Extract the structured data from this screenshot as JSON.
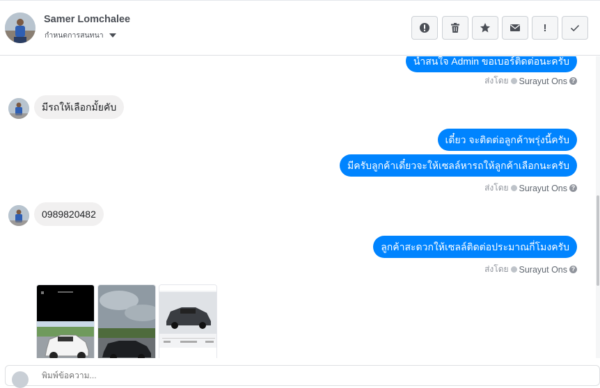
{
  "header": {
    "contact_name": "Samer Lomchalee",
    "contact_subtitle": "กำหนดการสนทนา",
    "actions": [
      {
        "name": "mark-spam",
        "icon": "alert-circle-icon"
      },
      {
        "name": "delete",
        "icon": "trash-icon"
      },
      {
        "name": "star",
        "icon": "star-icon"
      },
      {
        "name": "mark-unread",
        "icon": "envelope-icon"
      },
      {
        "name": "follow-up",
        "icon": "exclamation-icon",
        "label": "!"
      },
      {
        "name": "mark-done",
        "icon": "checkmark-icon"
      }
    ]
  },
  "messages": {
    "m1": "นำสนใจ Admin ขอเบอร์ติดต่อนะครับ",
    "m2": "มีรถให้เลือกมั้ยคับ",
    "m3": "เดี๋ยว จะติดต่อลูกค้าพรุ่งนี้ครับ",
    "m4": "มีครับลูกค้าเดี๋ยวจะให้เซลล์หารถให้ลูกค้าเลือกนะครับ",
    "m5": "0989820482",
    "m6": "ลูกค้าสะดวกให้เซลล์ติดต่อประมาณกี่โมงครับ"
  },
  "sent_by": {
    "prefix": "ส่งโดย",
    "name": "Surayut Ons",
    "help": "?"
  },
  "composer": {
    "placeholder": "พิมพ์ข้อความ..."
  },
  "colors": {
    "outgoing": "#0084ff",
    "incoming": "#f1f0f0"
  }
}
